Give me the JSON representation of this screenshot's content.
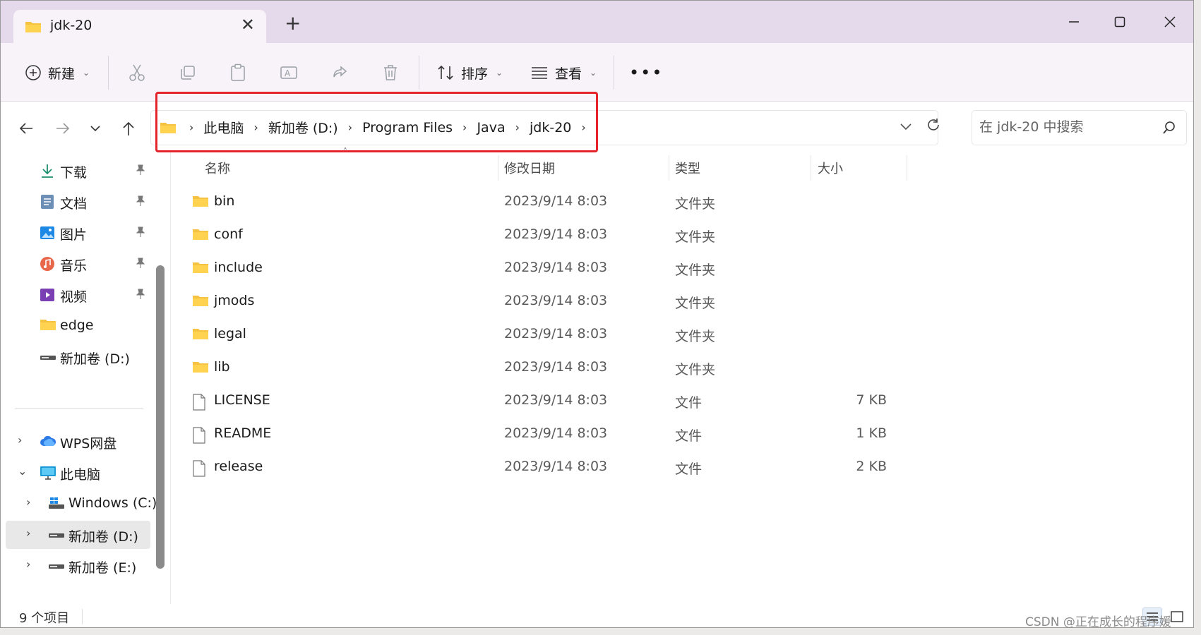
{
  "window": {
    "tab_title": "jdk-20",
    "controls": [
      "minimize-icon",
      "maximize-icon",
      "close-icon"
    ]
  },
  "toolbar": {
    "new_label": "新建",
    "sort_label": "排序",
    "view_label": "查看",
    "icons": [
      "cut-icon",
      "copy-icon",
      "paste-icon",
      "rename-icon",
      "share-icon",
      "delete-icon",
      "more-icon"
    ]
  },
  "address": {
    "crumbs": [
      "此电脑",
      "新加卷 (D:)",
      "Program Files",
      "Java",
      "jdk-20"
    ],
    "search_placeholder": "在 jdk-20 中搜索",
    "highlight_color": "#e5232a"
  },
  "sidebar": {
    "quick_access": [
      {
        "label": "下载",
        "icon": "download-icon"
      },
      {
        "label": "文档",
        "icon": "document-icon"
      },
      {
        "label": "图片",
        "icon": "picture-icon"
      },
      {
        "label": "音乐",
        "icon": "music-icon"
      },
      {
        "label": "视频",
        "icon": "video-icon"
      },
      {
        "label": "edge",
        "icon": "folder-icon"
      },
      {
        "label": "新加卷 (D:)",
        "icon": "drive-icon"
      }
    ],
    "tree": [
      {
        "label": "WPS网盘",
        "icon": "cloud-icon"
      },
      {
        "label": "此电脑",
        "icon": "computer-icon"
      },
      {
        "label": "Windows  (C:)",
        "icon": "windows-drive-icon"
      },
      {
        "label": "新加卷 (D:)",
        "icon": "drive-icon"
      },
      {
        "label": "新加卷 (E:)",
        "icon": "drive-icon"
      }
    ],
    "selected": "新加卷 (D:)"
  },
  "columns": {
    "name": "名称",
    "date": "修改日期",
    "type": "类型",
    "size": "大小"
  },
  "files": [
    {
      "name": "bin",
      "date": "2023/9/14 8:03",
      "type": "文件夹",
      "size": "",
      "icon": "folder-icon"
    },
    {
      "name": "conf",
      "date": "2023/9/14 8:03",
      "type": "文件夹",
      "size": "",
      "icon": "folder-icon"
    },
    {
      "name": "include",
      "date": "2023/9/14 8:03",
      "type": "文件夹",
      "size": "",
      "icon": "folder-icon"
    },
    {
      "name": "jmods",
      "date": "2023/9/14 8:03",
      "type": "文件夹",
      "size": "",
      "icon": "folder-icon"
    },
    {
      "name": "legal",
      "date": "2023/9/14 8:03",
      "type": "文件夹",
      "size": "",
      "icon": "folder-icon"
    },
    {
      "name": "lib",
      "date": "2023/9/14 8:03",
      "type": "文件夹",
      "size": "",
      "icon": "folder-icon"
    },
    {
      "name": "LICENSE",
      "date": "2023/9/14 8:03",
      "type": "文件",
      "size": "7 KB",
      "icon": "file-icon"
    },
    {
      "name": "README",
      "date": "2023/9/14 8:03",
      "type": "文件",
      "size": "1 KB",
      "icon": "file-icon"
    },
    {
      "name": "release",
      "date": "2023/9/14 8:03",
      "type": "文件",
      "size": "2 KB",
      "icon": "file-icon"
    }
  ],
  "status": {
    "item_count": "9 个项目"
  },
  "watermark": "CSDN @正在成长的程序媛"
}
